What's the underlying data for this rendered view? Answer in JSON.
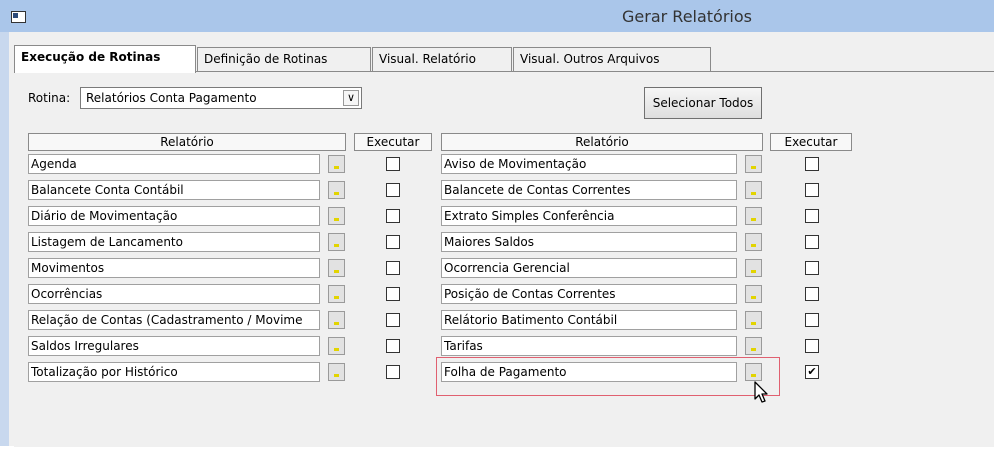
{
  "window": {
    "title": "Gerar Relatórios"
  },
  "tabs": [
    "Execução de Rotinas",
    "Definição de Rotinas",
    "Visual. Relatório",
    "Visual. Outros Arquivos"
  ],
  "rotina": {
    "label": "Rotina:",
    "value": "Relatórios Conta Pagamento"
  },
  "select_all_button": {
    "label": "Selecionar Todos"
  },
  "headers": {
    "relatorio": "Relatório",
    "executar": "Executar"
  },
  "left_reports": [
    {
      "name": "Agenda",
      "checked": false
    },
    {
      "name": "Balancete Conta Contábil",
      "checked": false
    },
    {
      "name": "Diário de Movimentação",
      "checked": false
    },
    {
      "name": "Listagem de Lancamento",
      "checked": false
    },
    {
      "name": "Movimentos",
      "checked": false
    },
    {
      "name": "Ocorrências",
      "checked": false
    },
    {
      "name": "Relação de Contas (Cadastramento / Movime",
      "checked": false
    },
    {
      "name": "Saldos Irregulares",
      "checked": false
    },
    {
      "name": "Totalização por Histórico",
      "checked": false
    }
  ],
  "right_reports": [
    {
      "name": "Aviso de Movimentação",
      "checked": false
    },
    {
      "name": "Balancete de Contas Correntes",
      "checked": false
    },
    {
      "name": "Extrato Simples Conferência",
      "checked": false
    },
    {
      "name": "Maiores Saldos",
      "checked": false
    },
    {
      "name": "Ocorrencia Gerencial",
      "checked": false
    },
    {
      "name": "Posição de Contas Correntes",
      "checked": false
    },
    {
      "name": "Relátorio Batimento Contábil",
      "checked": false
    },
    {
      "name": "Tarifas",
      "checked": false
    },
    {
      "name": "Folha de Pagamento",
      "checked": true
    }
  ],
  "icons": {
    "window": "app-window-icon",
    "lookup": "lookup-button-icon",
    "cursor": "mouse-pointer-icon"
  }
}
